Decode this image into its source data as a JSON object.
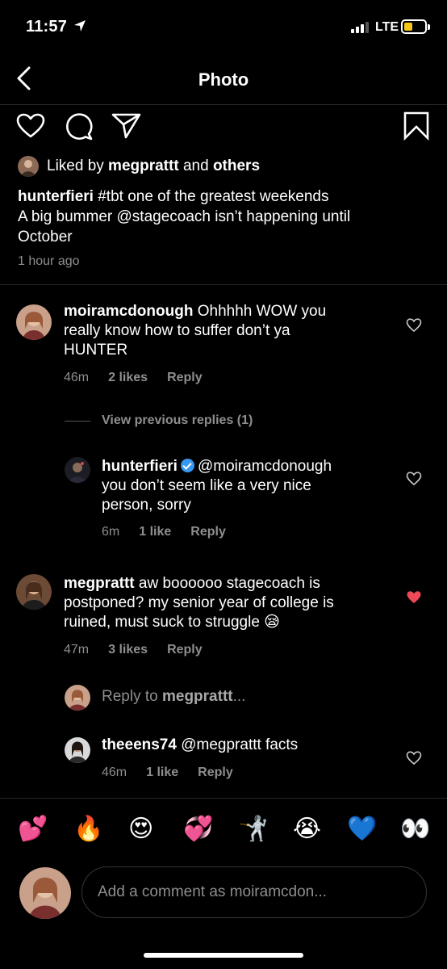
{
  "status_bar": {
    "time": "11:57",
    "network": "LTE",
    "battery_color": "#f5c518"
  },
  "nav": {
    "title": "Photo",
    "back_icon": "chevron-left-icon"
  },
  "actions": {
    "icons": [
      "heart-outline-icon",
      "comment-icon",
      "share-icon",
      "bookmark-icon"
    ]
  },
  "likes": {
    "prefix": "Liked by ",
    "user": "megprattt",
    "middle": " and ",
    "others": "others"
  },
  "caption": {
    "username": "hunterfieri",
    "line1": " #tbt one of the greatest weekends",
    "line2": "A big bummer @stagecoach isn’t happening until",
    "line3": "October",
    "time": "1 hour ago"
  },
  "comments": [
    {
      "username": "moiramcdonough",
      "text_line1": " Ohhhhh WOW you",
      "text_line2": "really know how to suffer  don’t ya",
      "text_line3": "HUNTER",
      "time": "46m",
      "likes": "2 likes",
      "reply": "Reply",
      "liked": false
    },
    {
      "view_previous": "View previous replies (1)",
      "username": "hunterfieri",
      "verified": true,
      "text_line1": "@moiramcdonough",
      "text_line2": "you don’t seem like a very nice",
      "text_line3": "person, sorry",
      "time": "6m",
      "likes": "1 like",
      "reply": "Reply",
      "liked": false
    },
    {
      "username": "megprattt",
      "text_line1": " aw boooooo stagecoach is",
      "text_line2": "postponed? my senior year of college is",
      "text_line3": "ruined, must suck to struggle 😪",
      "time": "47m",
      "likes": "3 likes",
      "reply": "Reply",
      "liked": true
    },
    {
      "reply_to_prefix": "Reply to ",
      "reply_to_user": "megprattt",
      "reply_to_suffix": "...",
      "username": "theeens74",
      "text_line1": " @megprattt facts",
      "time": "46m",
      "likes": "1 like",
      "reply": "Reply",
      "liked": false
    }
  ],
  "emojis": [
    "💕",
    "🔥",
    "😍",
    "💞",
    "🤺",
    "😭",
    "💙",
    "👀"
  ],
  "comment_input": {
    "placeholder": "Add a comment as moiramcdon..."
  },
  "colors": {
    "heart_liked": "#ed4956",
    "secondary_text": "#8e8e8e",
    "verified": "#3897f0"
  }
}
